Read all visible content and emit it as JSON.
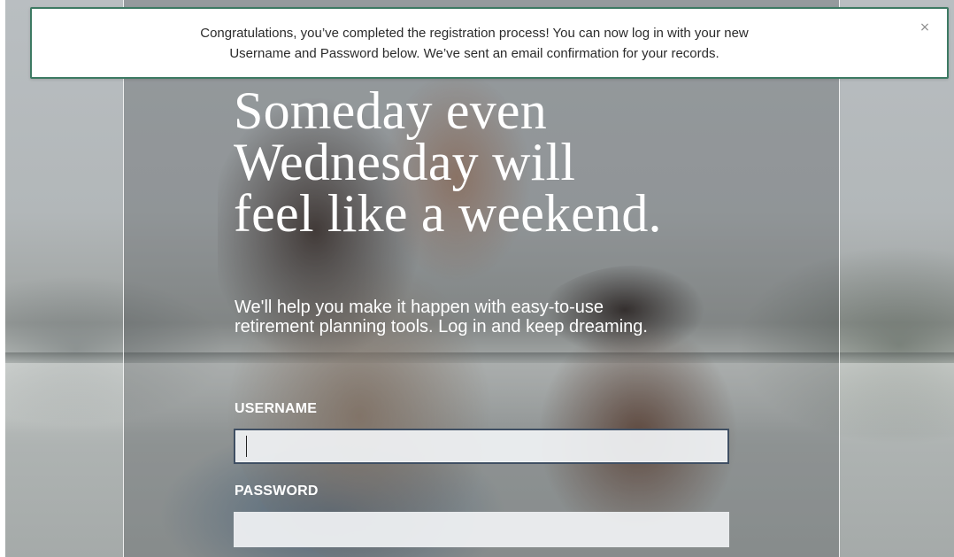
{
  "notification": {
    "line1": "Congratulations, you’ve completed the registration process! You can now log in with your new",
    "line2": "Username and Password below. We’ve sent an email confirmation for your records.",
    "close_glyph": "×",
    "border_color": "#3d7a63"
  },
  "hero": {
    "headline_lines": [
      "Someday even",
      "Wednesday will",
      "feel like a weekend."
    ],
    "subhead_lines": [
      "We'll help you make it happen with easy-to-use",
      "retirement planning tools. Log in and keep dreaming."
    ]
  },
  "login": {
    "username_label": "USERNAME",
    "username_value": "",
    "password_label": "PASSWORD",
    "password_value": ""
  }
}
